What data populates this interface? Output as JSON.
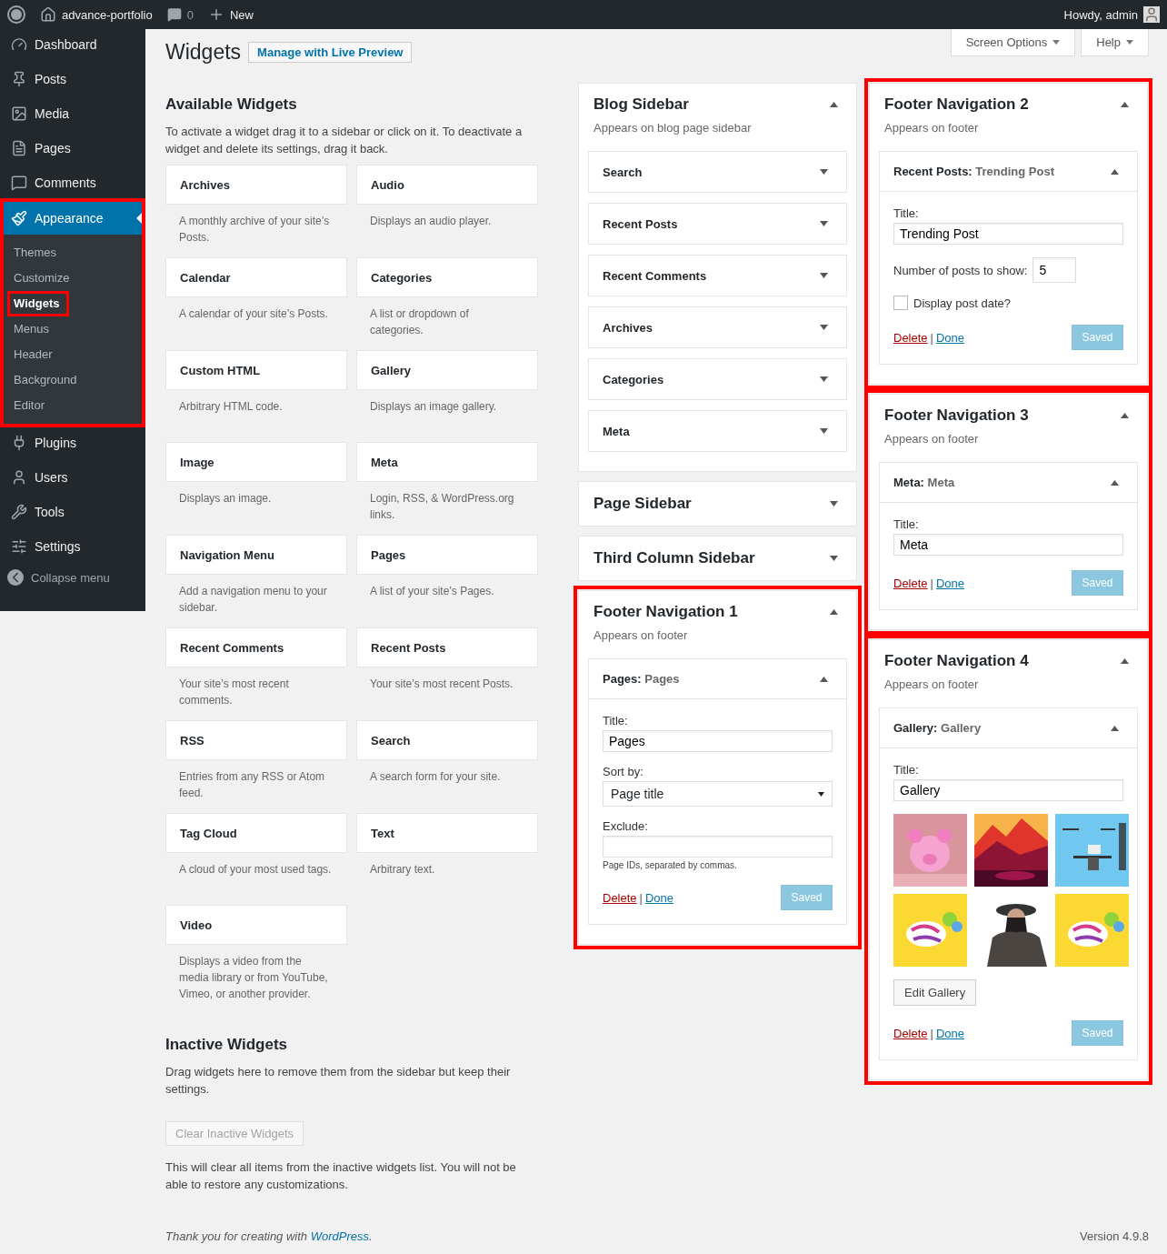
{
  "admin_bar": {
    "site": "advance-portfolio",
    "comments": "0",
    "new": "New",
    "greeting": "Howdy, admin"
  },
  "menu": {
    "items": [
      {
        "label": "Dashboard",
        "selected": false,
        "highlighted": false
      },
      {
        "label": "Posts",
        "selected": false,
        "highlighted": false
      },
      {
        "label": "Media",
        "selected": false,
        "highlighted": false
      },
      {
        "label": "Pages",
        "selected": false,
        "highlighted": false
      },
      {
        "label": "Comments",
        "selected": false,
        "highlighted": false
      },
      {
        "label": "Appearance",
        "selected": true,
        "highlighted": true,
        "submenu": [
          {
            "label": "Themes",
            "selected": false,
            "highlighted": false
          },
          {
            "label": "Customize",
            "selected": false,
            "highlighted": false
          },
          {
            "label": "Widgets",
            "selected": true,
            "highlighted": true
          },
          {
            "label": "Menus",
            "selected": false,
            "highlighted": false
          },
          {
            "label": "Header",
            "selected": false,
            "highlighted": false
          },
          {
            "label": "Background",
            "selected": false,
            "highlighted": false
          },
          {
            "label": "Editor",
            "selected": false,
            "highlighted": false
          }
        ]
      },
      {
        "label": "Plugins",
        "selected": false,
        "highlighted": false
      },
      {
        "label": "Users",
        "selected": false,
        "highlighted": false
      },
      {
        "label": "Tools",
        "selected": false,
        "highlighted": false
      },
      {
        "label": "Settings",
        "selected": false,
        "highlighted": false
      }
    ],
    "collapse": "Collapse menu"
  },
  "screen_meta_buttons": [
    "Screen Options",
    "Help"
  ],
  "page_title": "Widgets",
  "live_preview_button": "Manage with Live Preview",
  "available_widgets": {
    "title": "Available Widgets",
    "description": "To activate a widget drag it to a sidebar or click on it. To deactivate a widget and delete its settings, drag it back.",
    "widgets": [
      {
        "name": "Archives",
        "description": "A monthly archive of your site’s Posts."
      },
      {
        "name": "Audio",
        "description": "Displays an audio player."
      },
      {
        "name": "Calendar",
        "description": "A calendar of your site’s Posts."
      },
      {
        "name": "Categories",
        "description": "A list or dropdown of categories."
      },
      {
        "name": "Custom HTML",
        "description": "Arbitrary HTML code."
      },
      {
        "name": "Gallery",
        "description": "Displays an image gallery."
      },
      {
        "name": "Image",
        "description": "Displays an image."
      },
      {
        "name": "Meta",
        "description": "Login, RSS, & WordPress.org links."
      },
      {
        "name": "Navigation Menu",
        "description": "Add a navigation menu to your sidebar."
      },
      {
        "name": "Pages",
        "description": "A list of your site’s Pages."
      },
      {
        "name": "Recent Comments",
        "description": "Your site’s most recent comments."
      },
      {
        "name": "Recent Posts",
        "description": "Your site’s most recent Posts."
      },
      {
        "name": "RSS",
        "description": "Entries from any RSS or Atom feed."
      },
      {
        "name": "Search",
        "description": "A search form for your site."
      },
      {
        "name": "Tag Cloud",
        "description": "A cloud of your most used tags."
      },
      {
        "name": "Text",
        "description": "Arbitrary text."
      },
      {
        "name": "Video",
        "description": "Displays a video from the media library or from YouTube, Vimeo, or another provider."
      }
    ]
  },
  "inactive_widgets": {
    "title": "Inactive Widgets",
    "description": "Drag widgets here to remove them from the sidebar but keep their settings.",
    "clear_button": {
      "label": "Clear Inactive Widgets",
      "disabled": true
    },
    "note": "This will clear all items from the inactive widgets list. You will not be able to restore any customizations."
  },
  "sidebar_columns": [
    [
      {
        "title": "Blog Sidebar",
        "description": "Appears on blog page sidebar",
        "expanded": true,
        "highlighted": false,
        "widgets": [
          {
            "name": "Search",
            "expanded": false
          },
          {
            "name": "Recent Posts",
            "expanded": false
          },
          {
            "name": "Recent Comments",
            "expanded": false
          },
          {
            "name": "Archives",
            "expanded": false
          },
          {
            "name": "Categories",
            "expanded": false
          },
          {
            "name": "Meta",
            "expanded": false
          }
        ]
      },
      {
        "title": "Page Sidebar",
        "expanded": false,
        "highlighted": false
      },
      {
        "title": "Third Column Sidebar",
        "expanded": false,
        "highlighted": false
      },
      {
        "title": "Footer Navigation 1",
        "description": "Appears on footer",
        "expanded": true,
        "highlighted": true,
        "widgets": [
          {
            "name": "Pages:",
            "in_title": "Pages",
            "expanded": true,
            "fields": [
              {
                "kind": "text",
                "label": "Title:",
                "value": "Pages"
              },
              {
                "kind": "select",
                "label": "Sort by:",
                "value": "Page title"
              },
              {
                "kind": "text",
                "label": "Exclude:",
                "hint": "Page IDs, separated by commas."
              }
            ],
            "links": [
              "Delete",
              "Done"
            ],
            "separator": "|",
            "save_button": {
              "label": "Saved",
              "disabled": true
            }
          }
        ]
      }
    ],
    [
      {
        "title": "Footer Navigation 2",
        "description": "Appears on footer",
        "expanded": true,
        "highlighted": true,
        "widgets": [
          {
            "name": "Recent Posts:",
            "in_title": "Trending Post",
            "expanded": true,
            "fields": [
              {
                "kind": "text",
                "label": "Title:",
                "value": "Trending Post"
              },
              {
                "kind": "number",
                "label": "Number of posts to show:",
                "value": "5"
              },
              {
                "kind": "checkbox",
                "label": "Display post date?",
                "checked": false
              }
            ],
            "links": [
              "Delete",
              "Done"
            ],
            "separator": "|",
            "save_button": {
              "label": "Saved",
              "disabled": true
            }
          }
        ]
      },
      {
        "title": "Footer Navigation 3",
        "description": "Appears on footer",
        "expanded": true,
        "highlighted": true,
        "widgets": [
          {
            "name": "Meta:",
            "in_title": "Meta",
            "expanded": true,
            "fields": [
              {
                "kind": "text",
                "label": "Title:",
                "value": "Meta"
              }
            ],
            "links": [
              "Delete",
              "Done"
            ],
            "separator": "|",
            "save_button": {
              "label": "Saved",
              "disabled": true
            }
          }
        ]
      },
      {
        "title": "Footer Navigation 4",
        "description": "Appears on footer",
        "expanded": true,
        "highlighted": true,
        "widgets": [
          {
            "name": "Gallery:",
            "in_title": "Gallery",
            "expanded": true,
            "fields": [
              {
                "kind": "text",
                "label": "Title:",
                "value": "Gallery"
              },
              {
                "kind": "gallery",
                "button": "Edit Gallery"
              }
            ],
            "links": [
              "Delete",
              "Done"
            ],
            "separator": "|",
            "save_button": {
              "label": "Saved",
              "disabled": true
            }
          }
        ]
      }
    ]
  ],
  "footer": {
    "text": "Thank you for creating with",
    "link": "WordPress",
    "end": ".",
    "version": "Version 4.9.8"
  }
}
